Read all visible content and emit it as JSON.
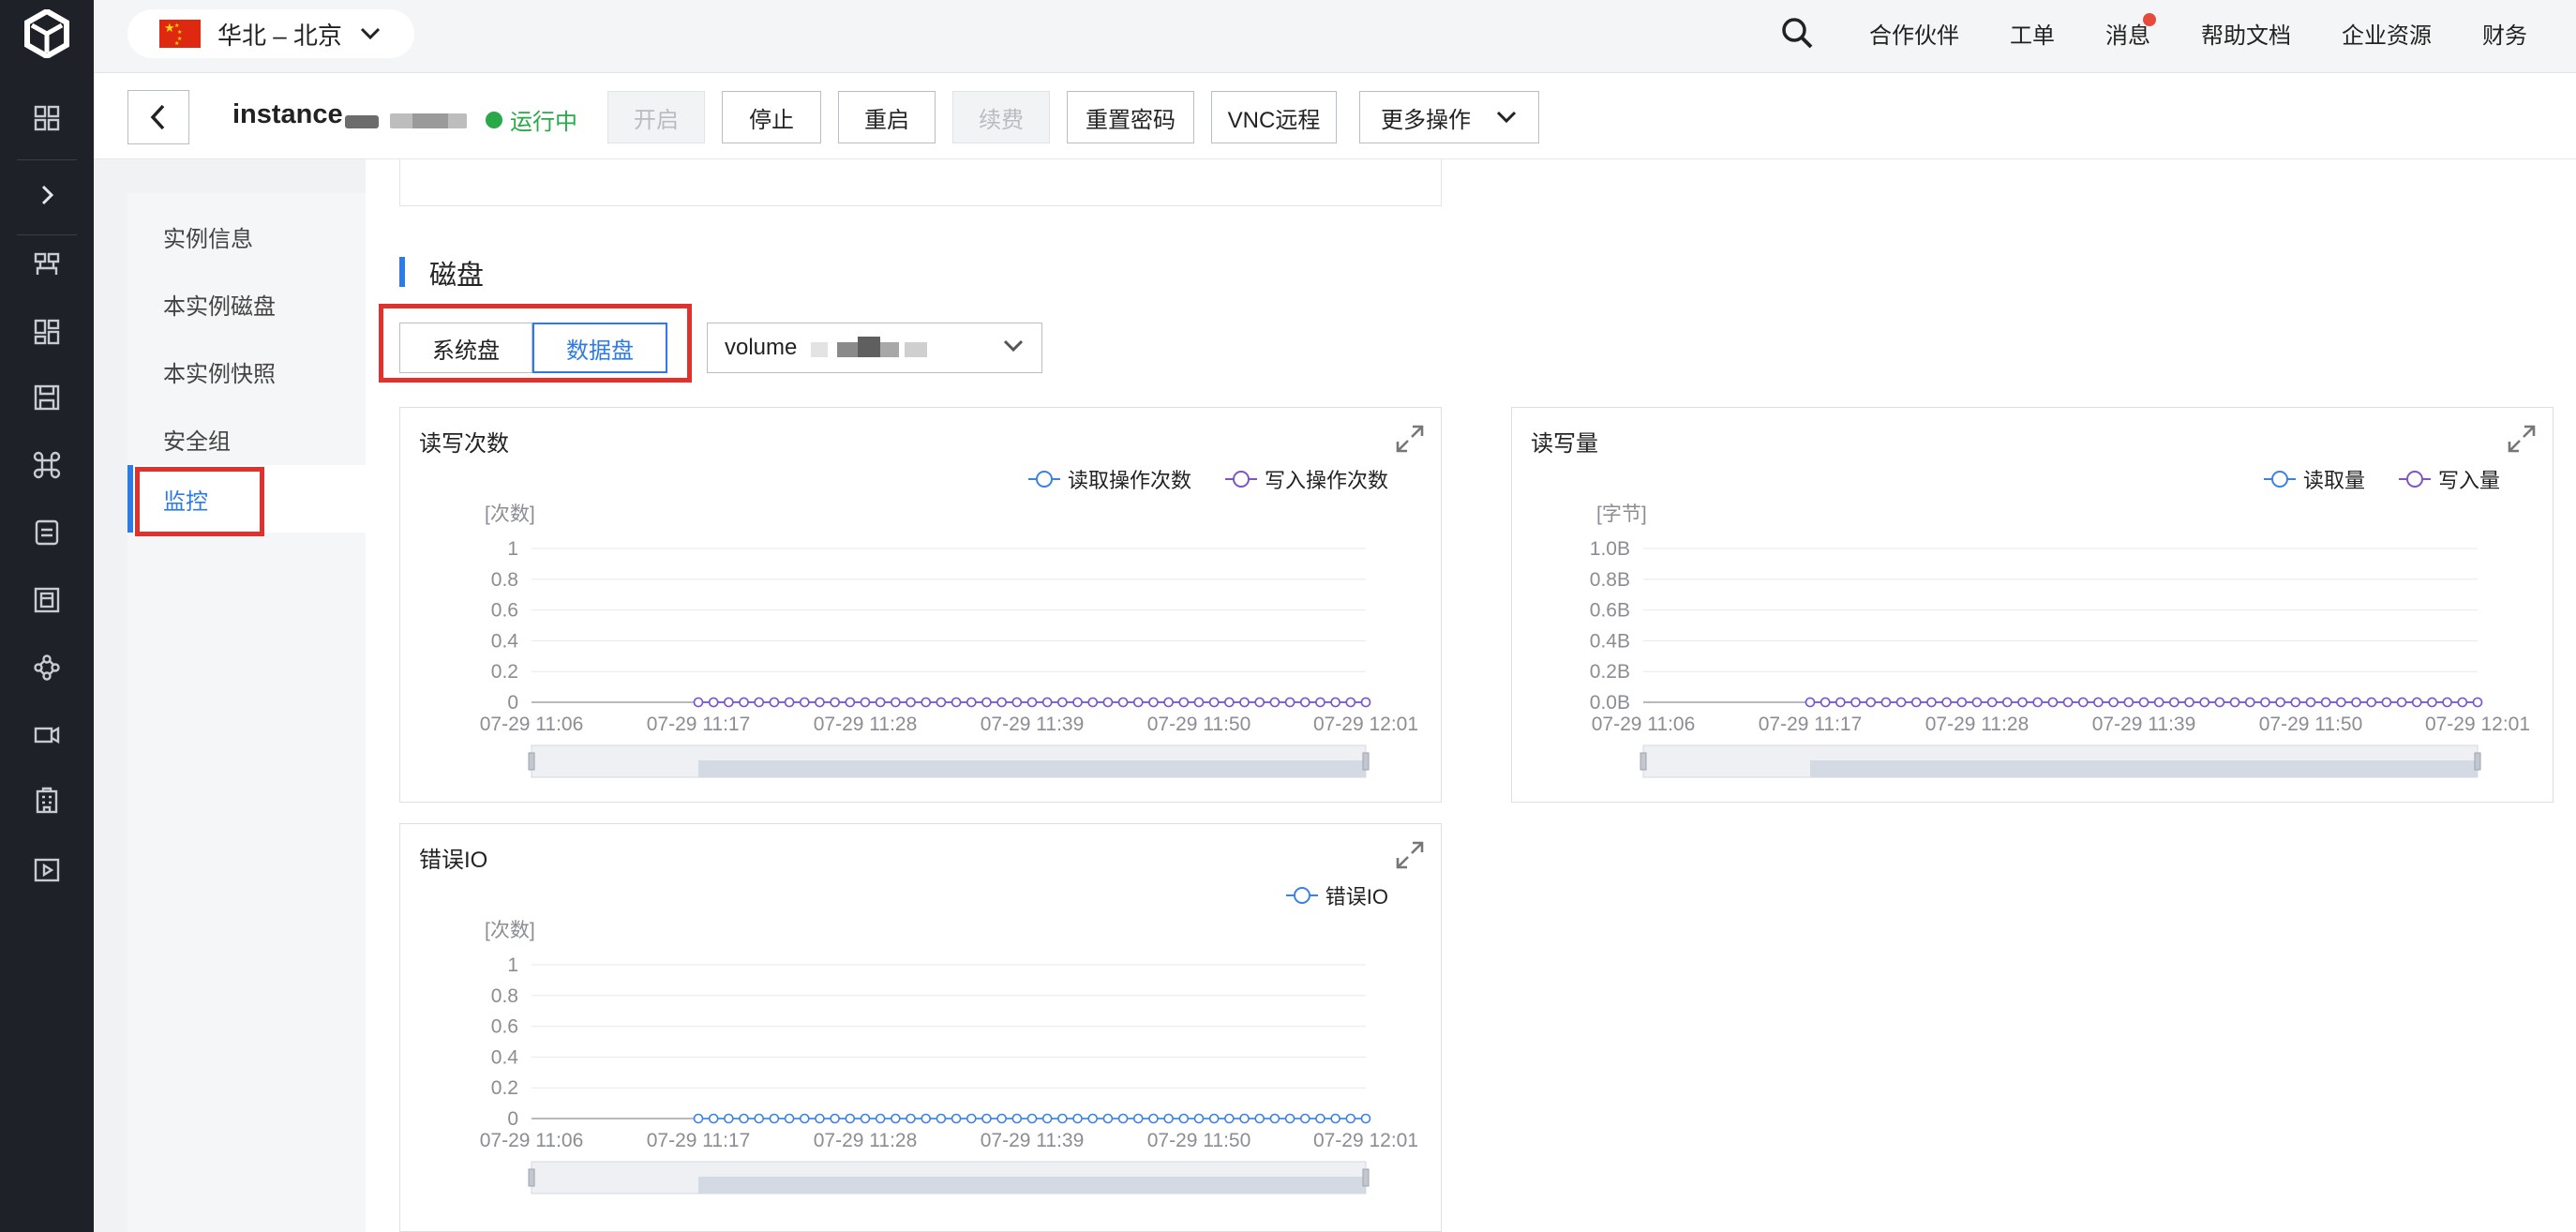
{
  "topbar": {
    "region": "华北 – 北京",
    "nav": [
      "合作伙伴",
      "工单",
      "消息",
      "帮助文档",
      "企业资源",
      "财务"
    ]
  },
  "instance": {
    "name": "instance",
    "status": "运行中",
    "buttons": {
      "start": "开启",
      "stop": "停止",
      "restart": "重启",
      "renew": "续费",
      "reset_password": "重置密码",
      "vnc": "VNC远程",
      "more": "更多操作"
    }
  },
  "subnav": {
    "items": [
      "实例信息",
      "本实例磁盘",
      "本实例快照",
      "安全组",
      "监控"
    ],
    "active": "监控"
  },
  "section": {
    "title": "磁盘",
    "tabs": [
      "系统盘",
      "数据盘"
    ],
    "active_tab": "数据盘",
    "volume_select": "volume"
  },
  "colors": {
    "accent": "#2d7be5",
    "status_green": "#29a948",
    "read_series": "#3b82e4",
    "write_series": "#7d55c7",
    "highlight_red": "#e0312c"
  },
  "chart_data": [
    {
      "type": "line",
      "title": "读写次数",
      "ylabel": "[次数]",
      "y_ticks": [
        "1",
        "0.8",
        "0.6",
        "0.4",
        "0.2",
        "0"
      ],
      "ylim": [
        0,
        1
      ],
      "x_ticks": [
        "07-29 11:06",
        "07-29 11:17",
        "07-29 11:28",
        "07-29 11:39",
        "07-29 11:50",
        "07-29 12:01"
      ],
      "series": [
        {
          "name": "读取操作次数",
          "color": "#3b82e4",
          "start": "07-29 11:17",
          "end": "07-29 12:01",
          "points": 45,
          "value": 0
        },
        {
          "name": "写入操作次数",
          "color": "#7d55c7",
          "start": "07-29 11:17",
          "end": "07-29 12:01",
          "points": 45,
          "value": 0
        }
      ],
      "grid": true,
      "legend": "top-right"
    },
    {
      "type": "line",
      "title": "读写量",
      "ylabel": "[字节]",
      "y_ticks": [
        "1.0B",
        "0.8B",
        "0.6B",
        "0.4B",
        "0.2B",
        "0.0B"
      ],
      "ylim": [
        0,
        1
      ],
      "x_ticks": [
        "07-29 11:06",
        "07-29 11:17",
        "07-29 11:28",
        "07-29 11:39",
        "07-29 11:50",
        "07-29 12:01"
      ],
      "series": [
        {
          "name": "读取量",
          "color": "#3b82e4",
          "start": "07-29 11:17",
          "end": "07-29 12:01",
          "points": 45,
          "value": 0
        },
        {
          "name": "写入量",
          "color": "#7d55c7",
          "start": "07-29 11:17",
          "end": "07-29 12:01",
          "points": 45,
          "value": 0
        }
      ],
      "grid": true,
      "legend": "top-right"
    },
    {
      "type": "line",
      "title": "错误IO",
      "ylabel": "[次数]",
      "y_ticks": [
        "1",
        "0.8",
        "0.6",
        "0.4",
        "0.2",
        "0"
      ],
      "ylim": [
        0,
        1
      ],
      "x_ticks": [
        "07-29 11:06",
        "07-29 11:17",
        "07-29 11:28",
        "07-29 11:39",
        "07-29 11:50",
        "07-29 12:01"
      ],
      "series": [
        {
          "name": "错误IO",
          "color": "#3b82e4",
          "start": "07-29 11:17",
          "end": "07-29 12:01",
          "points": 45,
          "value": 0
        }
      ],
      "grid": true,
      "legend": "top-right"
    }
  ]
}
